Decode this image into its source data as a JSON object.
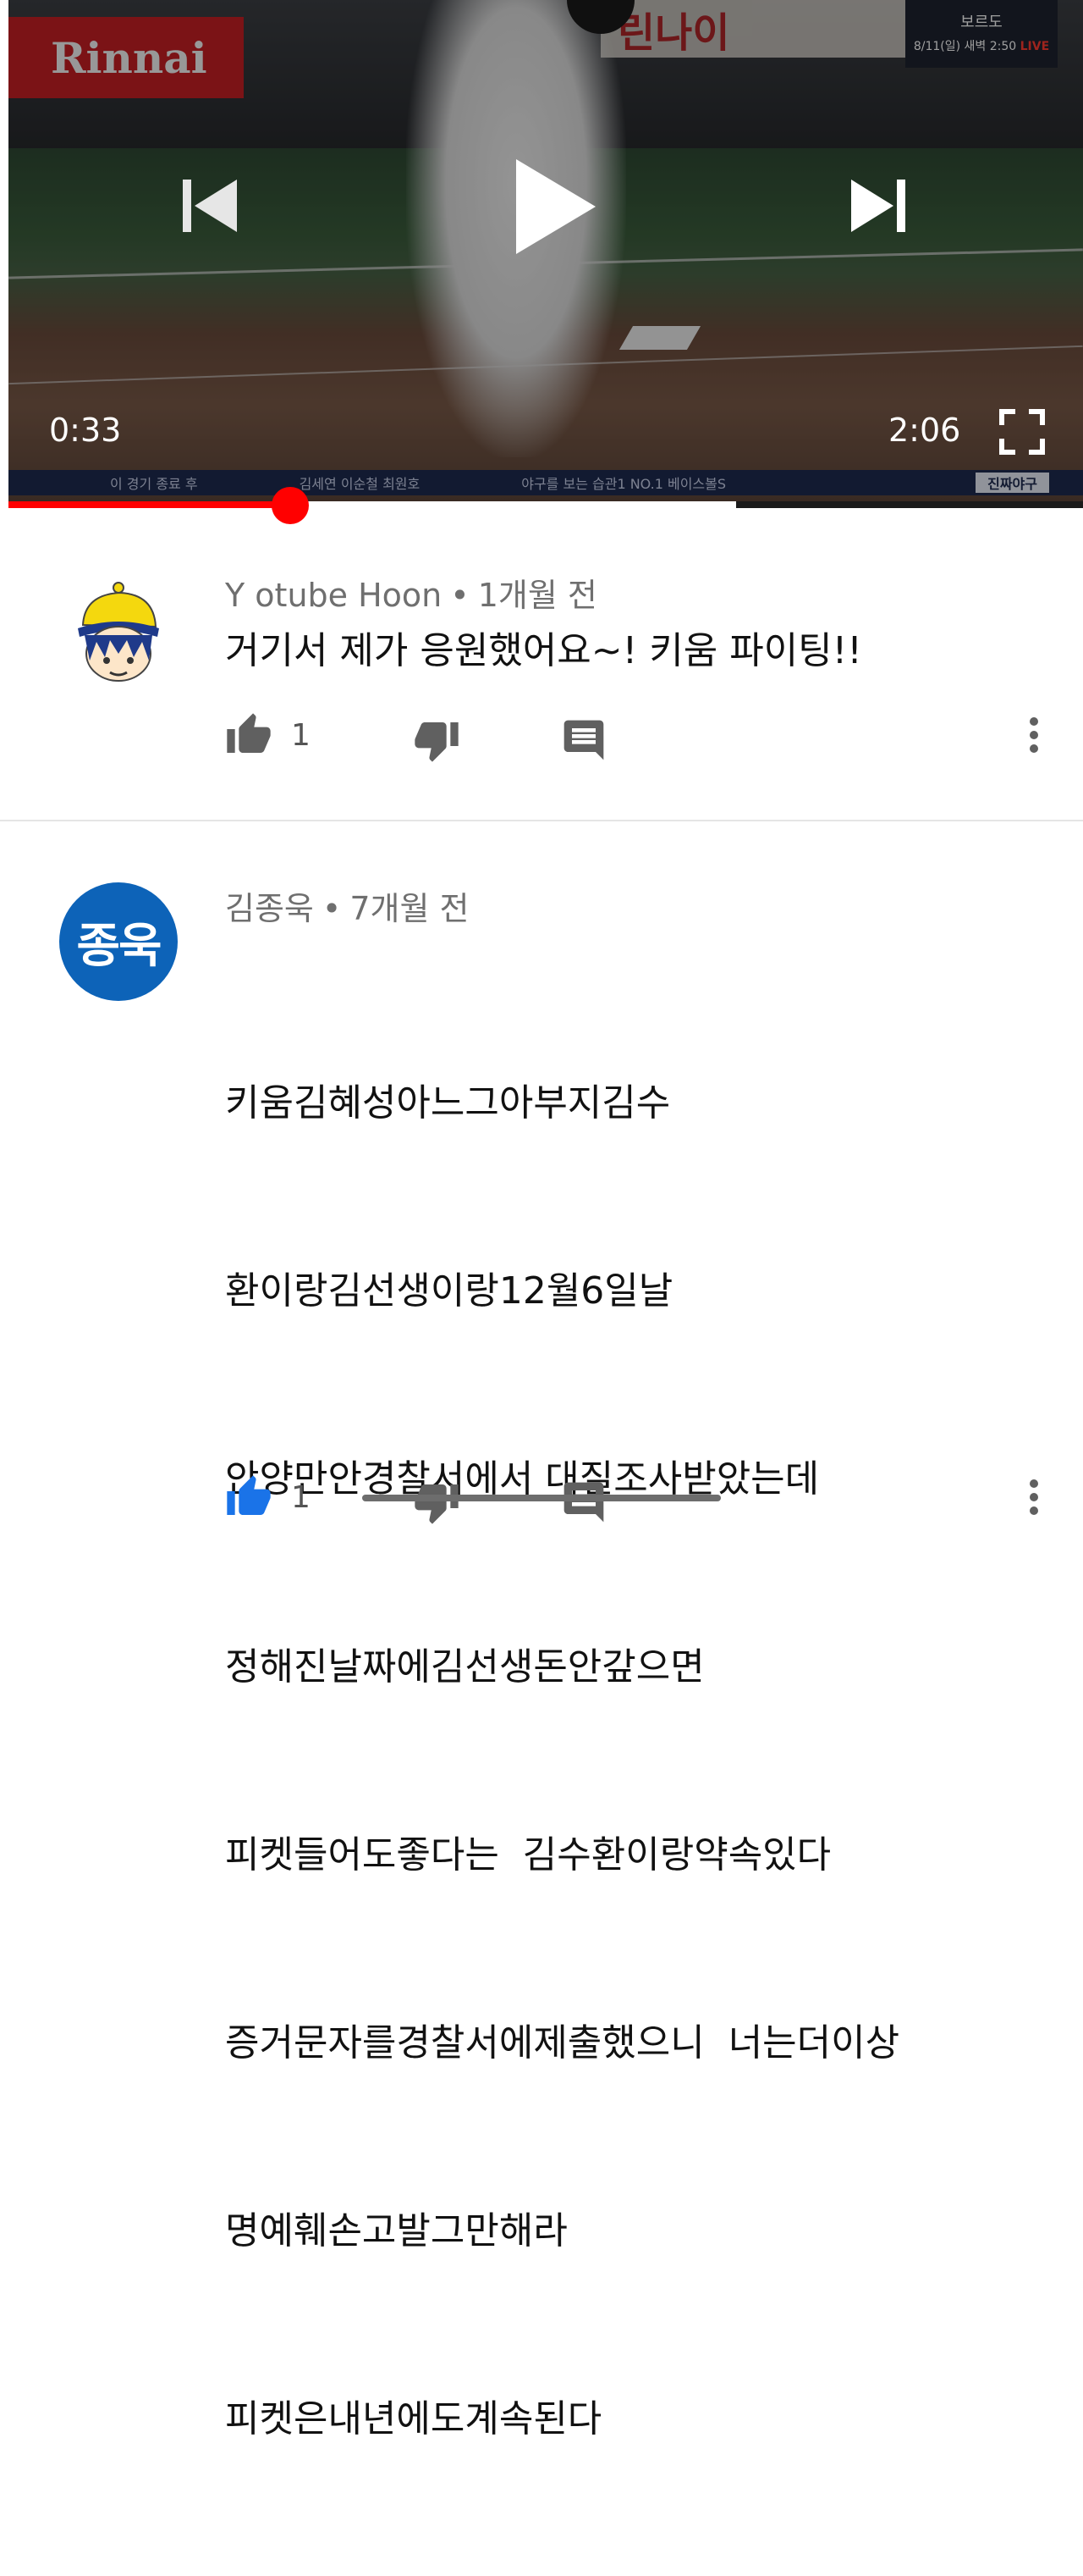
{
  "player": {
    "sponsor_board": "Rinnai",
    "banner_text": "린나이",
    "scorebox": {
      "line1": "보르도",
      "time": "8/11(일) 새벽 2:50",
      "live_label": "LIVE"
    },
    "ticker": [
      "이 경기 종료 후",
      "김세연 이순철 최원호",
      "야구를 보는 습관1 NO.1 베이스볼S"
    ],
    "ticker_brand": "진짜야구",
    "current_time": "0:33",
    "total_time": "2:06",
    "progress_fraction": 0.262,
    "buffer_fraction": 0.677,
    "icons": {
      "prev": "skip-previous-icon",
      "play": "play-icon",
      "next": "skip-next-icon",
      "fullscreen": "fullscreen-icon"
    }
  },
  "comments": [
    {
      "author": "Y otube Hoon",
      "age": "1개월 전",
      "lines": [
        "거기서 제가 응원했어요~! 키움 파이팅!!"
      ],
      "likes": "1",
      "avatar_style": "cartoon"
    },
    {
      "author": "김종욱",
      "age": "7개월 전",
      "avatar_text": "종욱",
      "lines": [
        "키움김혜성아느그아부지김수",
        "환이랑김선생이랑12월6일날",
        "안양만안경찰서에서 대질조사받았는데",
        "정해진날짜에김선생돈안갚으면",
        "피켓들어도좋다는  김수환이랑약속있다",
        "증거문자를경찰서에제출했으니  너는더이상",
        "명예훼손고발그만해라",
        "피켓은내년에도계속된다"
      ],
      "likes": "1"
    }
  ],
  "colors": {
    "progress": "#ff0000",
    "avatar_blue": "#0d63b8",
    "meta_text": "#6f6f6f"
  }
}
